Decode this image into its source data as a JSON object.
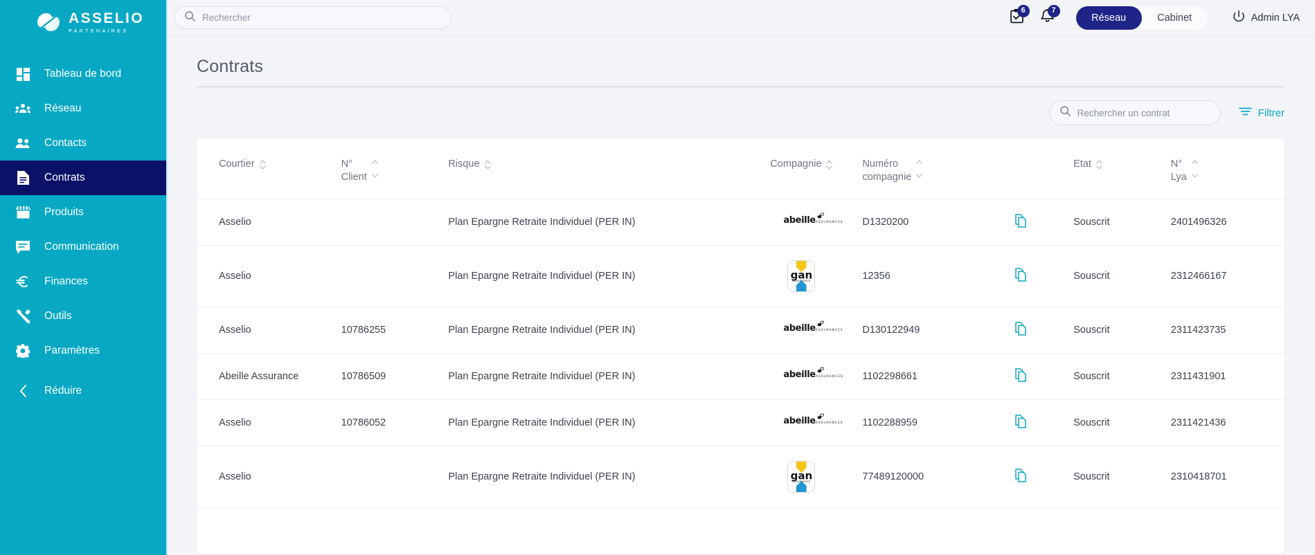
{
  "brand": {
    "name": "ASSELIO",
    "tagline": "PARTENAIRES",
    "logo_icon": "asselio-logo-icon"
  },
  "sidebar": {
    "collapse_label": "Réduire",
    "items": [
      {
        "label": "Tableau de bord",
        "icon": "dashboard-icon",
        "active": false
      },
      {
        "label": "Réseau",
        "icon": "network-people-icon",
        "active": false
      },
      {
        "label": "Contacts",
        "icon": "contacts-people-icon",
        "active": false
      },
      {
        "label": "Contrats",
        "icon": "document-icon",
        "active": true
      },
      {
        "label": "Produits",
        "icon": "store-icon",
        "active": false
      },
      {
        "label": "Communication",
        "icon": "chat-icon",
        "active": false
      },
      {
        "label": "Finances",
        "icon": "euro-icon",
        "active": false
      },
      {
        "label": "Outils",
        "icon": "tools-icon",
        "active": false
      },
      {
        "label": "Paramètres",
        "icon": "gear-icon",
        "active": false
      }
    ]
  },
  "topbar": {
    "search_placeholder": "Rechercher",
    "search_value": "",
    "tasks_badge": "6",
    "notifications_badge": "7",
    "segment": {
      "active": "Réseau",
      "inactive": "Cabinet"
    },
    "user_label": "Admin LYA",
    "power_icon": "power-icon"
  },
  "page": {
    "title": "Contrats",
    "search_placeholder": "Rechercher un contrat",
    "search_value": "",
    "filter_label": "Filtrer"
  },
  "table": {
    "columns": [
      {
        "key": "courtier",
        "label": "Courtier",
        "sortable": true
      },
      {
        "key": "client",
        "label": "N°\nClient",
        "sortable": true
      },
      {
        "key": "risque",
        "label": "Risque",
        "sortable": true
      },
      {
        "key": "compagnie",
        "label": "Compagnie",
        "sortable": true
      },
      {
        "key": "numero",
        "label": "Numéro\ncompagnie",
        "sortable": true
      },
      {
        "key": "copy",
        "label": "",
        "sortable": false
      },
      {
        "key": "etat",
        "label": "Etat",
        "sortable": true
      },
      {
        "key": "lya",
        "label": "N°\nLya",
        "sortable": true
      }
    ],
    "column_labels": {
      "courtier": "Courtier",
      "client_l1": "N°",
      "client_l2": "Client",
      "risque": "Risque",
      "compagnie": "Compagnie",
      "numero_l1": "Numéro",
      "numero_l2": "compagnie",
      "etat": "Etat",
      "lya_l1": "N°",
      "lya_l2": "Lya"
    },
    "rows": [
      {
        "courtier": "Asselio",
        "client": "",
        "risque": "Plan Epargne Retraite Individuel (PER IN)",
        "compagnie": "abeille",
        "compagnie_name": "abeille ASSURANCES",
        "numero": "D1320200",
        "etat": "Souscrit",
        "lya": "2401496326"
      },
      {
        "courtier": "Asselio",
        "client": "",
        "risque": "Plan Epargne Retraite Individuel (PER IN)",
        "compagnie": "gan",
        "compagnie_name": "gan ASSURANCES",
        "numero": "12356",
        "etat": "Souscrit",
        "lya": "2312466167"
      },
      {
        "courtier": "Asselio",
        "client": "10786255",
        "risque": "Plan Epargne Retraite Individuel (PER IN)",
        "compagnie": "abeille",
        "compagnie_name": "abeille ASSURANCES",
        "numero": "D130122949",
        "etat": "Souscrit",
        "lya": "2311423735"
      },
      {
        "courtier": "Abeille Assurance",
        "client": "10786509",
        "risque": "Plan Epargne Retraite Individuel (PER IN)",
        "compagnie": "abeille",
        "compagnie_name": "abeille ASSURANCES",
        "numero": "1102298661",
        "etat": "Souscrit",
        "lya": "2311431901"
      },
      {
        "courtier": "Asselio",
        "client": "10786052",
        "risque": "Plan Epargne Retraite Individuel (PER IN)",
        "compagnie": "abeille",
        "compagnie_name": "abeille ASSURANCES",
        "numero": "1102288959",
        "etat": "Souscrit",
        "lya": "2311421436"
      },
      {
        "courtier": "Asselio",
        "client": "",
        "risque": "Plan Epargne Retraite Individuel (PER IN)",
        "compagnie": "gan",
        "compagnie_name": "gan ASSURANCES",
        "numero": "77489120000",
        "etat": "Souscrit",
        "lya": "2310418701"
      }
    ],
    "copy_icon": "copy-document-icon"
  },
  "colors": {
    "sidebar_teal": "#06a8c4",
    "sidebar_active_navy": "#0c1168",
    "accent_blue": "#1f2488",
    "accent_cyan": "#06a8c4",
    "page_bg": "#f3f4f8",
    "card_bg": "#ffffff"
  }
}
